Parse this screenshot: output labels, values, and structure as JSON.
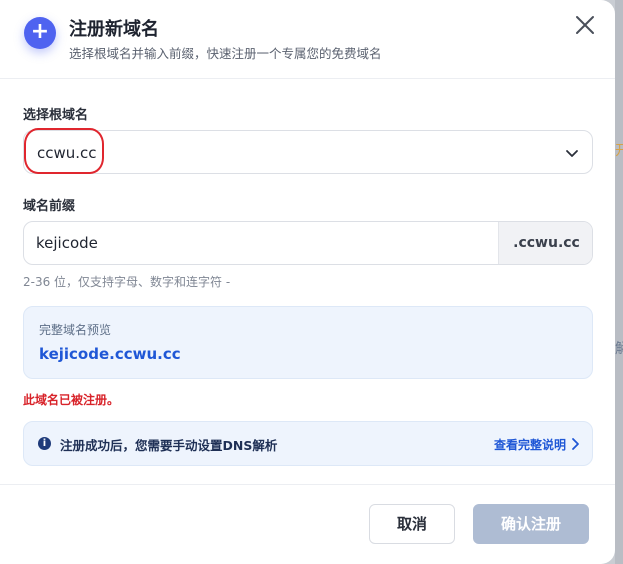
{
  "header": {
    "icon": "plus-icon",
    "title": "注册新域名",
    "subtitle": "选择根域名并输入前缀，快速注册一个专属您的免费域名",
    "close_icon": "close-icon"
  },
  "root_domain": {
    "label": "选择根域名",
    "selected": "ccwu.cc",
    "highlight_color": "#e0262e"
  },
  "prefix": {
    "label": "域名前缀",
    "value": "kejicode",
    "suffix": ".ccwu.cc",
    "hint": "2-36 位，仅支持字母、数字和连字符 -"
  },
  "preview": {
    "label": "完整域名预览",
    "value": "kejicode.ccwu.cc"
  },
  "error": "此域名已被注册。",
  "info": {
    "text": "注册成功后，您需要手动设置DNS解析",
    "link": "查看完整说明"
  },
  "footer": {
    "cancel": "取消",
    "confirm": "确认注册"
  },
  "colors": {
    "accent": "#4f63f0",
    "link": "#1f57d6",
    "error": "#d8232a",
    "confirm_disabled": "#aebcd3"
  }
}
